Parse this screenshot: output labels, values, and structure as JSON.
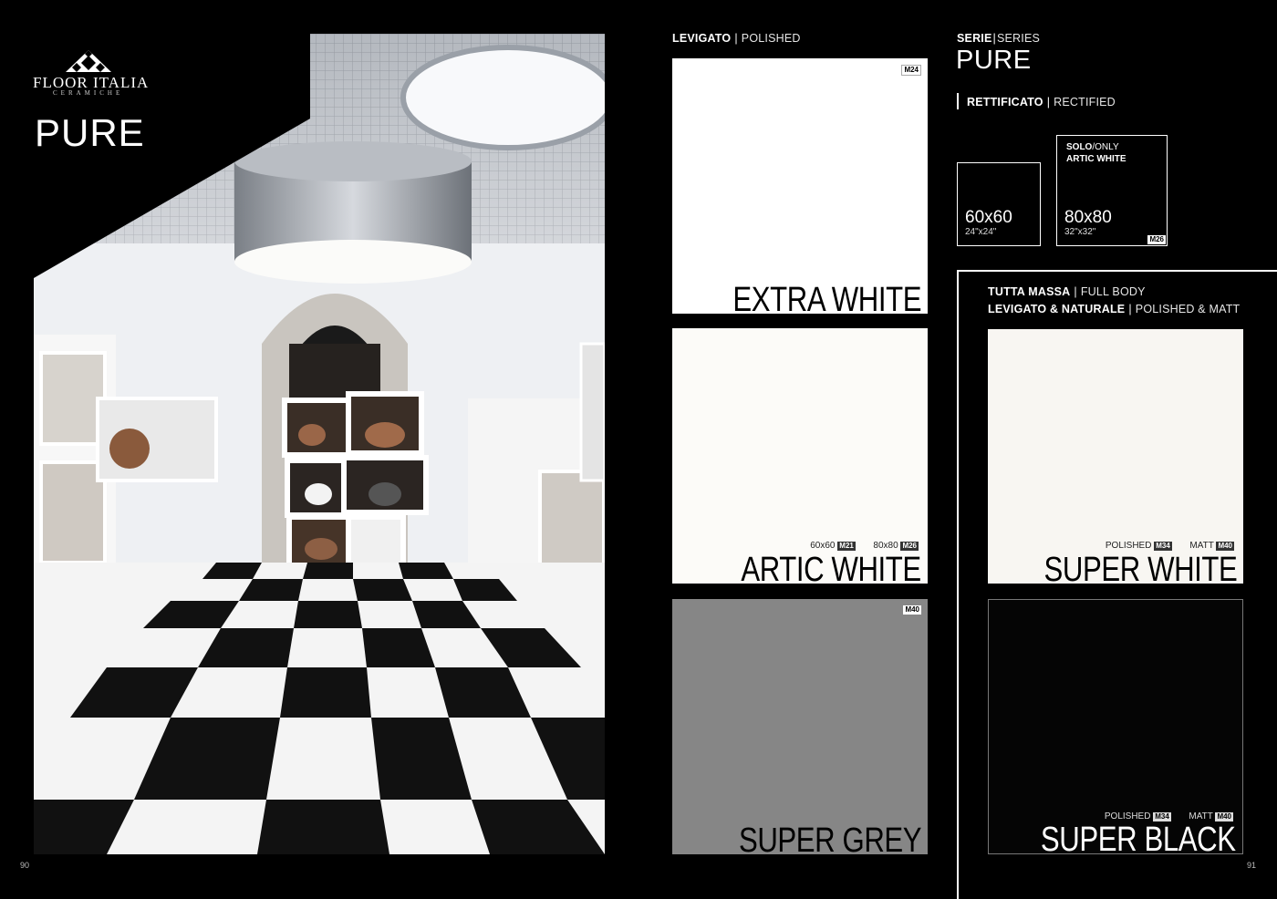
{
  "left_page": {
    "brand": "FLOOR ITALIA",
    "brand_sub": "CERAMICHE",
    "title": "PURE",
    "page_number": "90"
  },
  "right_page": {
    "polished_header": {
      "it": "LEVIGATO",
      "en": "POLISHED"
    },
    "series": {
      "label_it": "SERIE",
      "label_en": "SERIES",
      "name": "PURE"
    },
    "rectified": {
      "it": "RETTIFICATO",
      "en": "RECTIFIED"
    },
    "sizes": [
      {
        "main": "60x60",
        "inch": "24\"x24\""
      },
      {
        "main": "80x80",
        "inch": "32\"x32\"",
        "note_it": "SOLO",
        "note_en": "ONLY",
        "note_color": "ARTIC WHITE",
        "code": "M26"
      }
    ],
    "fullbody_header": {
      "line1_it": "TUTTA MASSA",
      "line1_en": "FULL BODY",
      "line2_it": "LEVIGATO & NATURALE",
      "line2_en": "POLISHED & MATT"
    },
    "tiles": {
      "extra_white": {
        "name": "EXTRA WHITE",
        "code": "M24",
        "color": "#ffffff"
      },
      "artic_white": {
        "name": "ARTIC WHITE",
        "size1": "60x60",
        "code1": "M21",
        "size2": "80x80",
        "code2": "M26",
        "color": "#fcfbf8"
      },
      "super_grey": {
        "name": "SUPER GREY",
        "code": "M40",
        "color": "#868686"
      },
      "super_white": {
        "name": "SUPER WHITE",
        "finish1": "POLISHED",
        "code1": "M34",
        "finish2": "MATT",
        "code2": "M40",
        "color": "#f8f6f2"
      },
      "super_black": {
        "name": "SUPER BLACK",
        "finish1": "POLISHED",
        "code1": "M34",
        "finish2": "MATT",
        "code2": "M40",
        "color": "#050505"
      }
    },
    "page_number": "91"
  }
}
